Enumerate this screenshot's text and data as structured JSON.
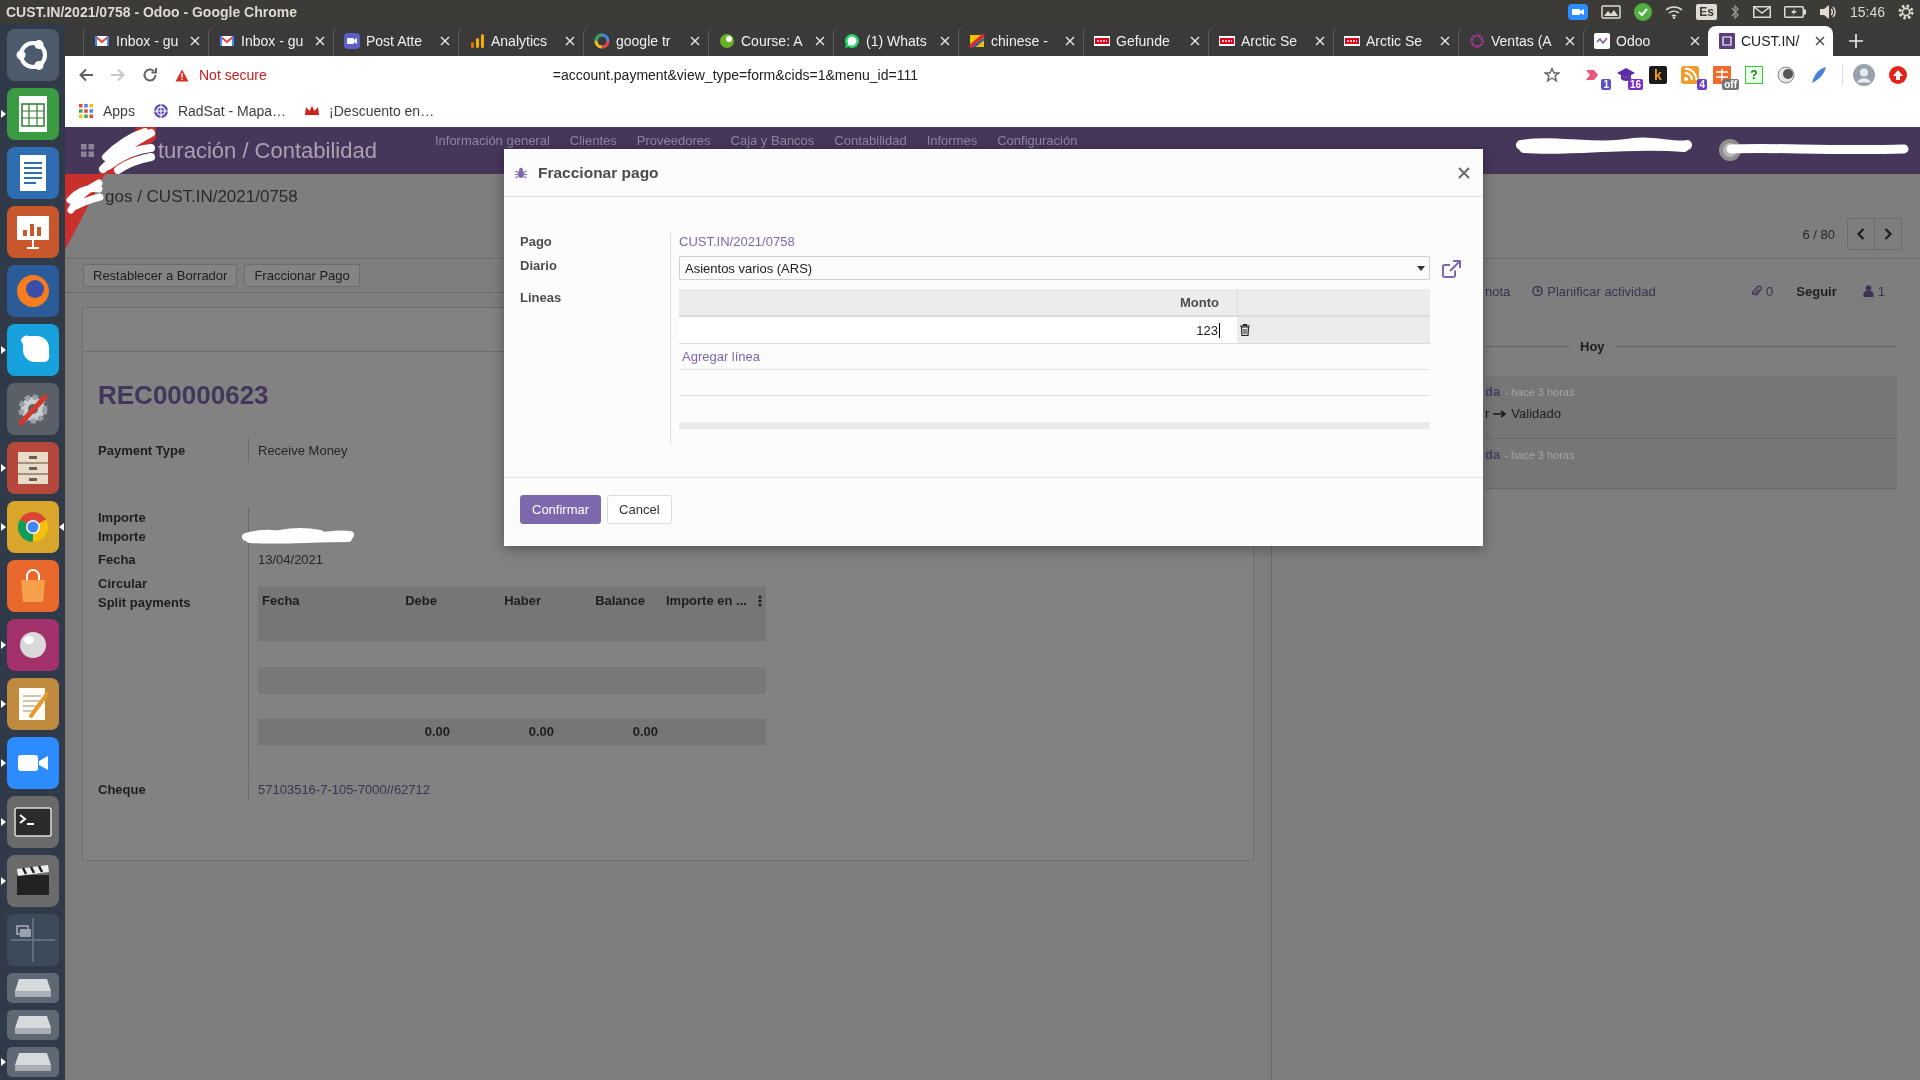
{
  "top_bar": {
    "title": "CUST.IN/2021/0758 - Odoo - Google Chrome",
    "keyboard": "Es",
    "time": "15:46"
  },
  "dock": [
    {
      "kind": "dash",
      "running": false,
      "focused": false
    },
    {
      "kind": "spreadsheet",
      "running": true,
      "focused": false
    },
    {
      "kind": "document",
      "running": false,
      "focused": false
    },
    {
      "kind": "presentation",
      "running": false,
      "focused": false
    },
    {
      "kind": "firefox",
      "running": false,
      "focused": false
    },
    {
      "kind": "skype",
      "running": true,
      "focused": false
    },
    {
      "kind": "settings",
      "running": false,
      "focused": false
    },
    {
      "kind": "files",
      "running": true,
      "focused": false
    },
    {
      "kind": "chrome",
      "running": true,
      "focused": true
    },
    {
      "kind": "store",
      "running": false,
      "focused": false
    },
    {
      "kind": "sphere",
      "running": true,
      "focused": false
    },
    {
      "kind": "notepad",
      "running": true,
      "focused": false
    },
    {
      "kind": "video",
      "running": true,
      "focused": false
    },
    {
      "kind": "terminal",
      "running": true,
      "focused": false
    },
    {
      "kind": "clapperboard",
      "running": true,
      "focused": false
    },
    {
      "kind": "workspaces",
      "running": false,
      "focused": false
    },
    {
      "kind": "drive",
      "running": false,
      "focused": false
    },
    {
      "kind": "drive",
      "running": false,
      "focused": false
    },
    {
      "kind": "drive",
      "running": true,
      "focused": false
    }
  ],
  "tabs": [
    {
      "title": "Inbox - gu",
      "kind": "mail",
      "selected": false
    },
    {
      "title": "Inbox - gu",
      "kind": "mail",
      "selected": false
    },
    {
      "title": "Post Atte",
      "kind": "video",
      "selected": false
    },
    {
      "title": "Analytics",
      "kind": "analytics",
      "selected": false
    },
    {
      "title": "google tr",
      "kind": "google",
      "selected": false
    },
    {
      "title": "Course: A",
      "kind": "course",
      "selected": false
    },
    {
      "title": "(1) Whats",
      "kind": "whatsapp",
      "selected": false
    },
    {
      "title": "chinese -",
      "kind": "flag",
      "selected": false
    },
    {
      "title": "Gefunde",
      "kind": "otto",
      "selected": false
    },
    {
      "title": "Arctic Se",
      "kind": "otto",
      "selected": false
    },
    {
      "title": "Arctic Se",
      "kind": "otto",
      "selected": false
    },
    {
      "title": "Ventas (A",
      "kind": "ring",
      "selected": false
    },
    {
      "title": "Odoo",
      "kind": "odoo",
      "selected": false
    },
    {
      "title": "CUST.IN/",
      "kind": "app",
      "selected": true
    }
  ],
  "nav_buttons": [
    {
      "kind": "back",
      "disabled": false
    },
    {
      "kind": "forward",
      "disabled": true
    },
    {
      "kind": "reload",
      "disabled": false
    }
  ],
  "address_bar": {
    "security": "Not secure",
    "url": "=account.payment&view_type=form&cids=1&menu_id=111"
  },
  "extensions": [
    {
      "kind": "arrows",
      "badge": "1"
    },
    {
      "kind": "cap",
      "badge": "16"
    },
    {
      "kind": "letter",
      "glyph": "k"
    },
    {
      "kind": "feed",
      "badge": "4"
    },
    {
      "kind": "grid",
      "badge": "off"
    },
    {
      "kind": "help",
      "glyph": "?"
    },
    {
      "kind": "moon"
    },
    {
      "kind": "feather"
    }
  ],
  "bookmarks": [
    {
      "kind": "apps",
      "label": "Apps"
    },
    {
      "kind": "globe",
      "label": "RadSat - Mapa…"
    },
    {
      "kind": "crown",
      "label": "¡Descuento en…"
    }
  ],
  "navbar": {
    "app_title": "turación / Contabilidad",
    "menu": [
      "Información general",
      "Clientes",
      "Proveedores",
      "Caja y Bancos",
      "Contabilidad",
      "Informes",
      "Configuración"
    ]
  },
  "control_panel": {
    "breadcrumb": "gos / CUST.IN/2021/0758",
    "pager": "6 / 80"
  },
  "header_buttons": [
    "Restablecer a Borrador",
    "Fraccionar Pago"
  ],
  "form": {
    "title": "REC00000623",
    "payment_type": {
      "label": "Payment Type",
      "value": "Receive Money"
    },
    "fields": [
      {
        "label": "Importe",
        "redacted": false
      },
      {
        "label": "Importe",
        "redacted": true
      },
      {
        "label": "Fecha",
        "value": "13/04/2021",
        "redacted": false
      },
      {
        "label": "Circular",
        "redacted": false
      }
    ],
    "split_payments": {
      "label": "Split payments",
      "columns": [
        {
          "label": "Fecha",
          "kind": "text"
        },
        {
          "label": "Debe",
          "kind": "number",
          "total": "0.00"
        },
        {
          "label": "Haber",
          "kind": "number",
          "total": "0.00"
        },
        {
          "label": "Balance",
          "kind": "number",
          "total": "0.00"
        },
        {
          "label": "Importe en ...",
          "kind": "text"
        }
      ]
    },
    "cheque": {
      "label": "Cheque",
      "value": "57103516-7-105-7000//62712"
    }
  },
  "chatter": {
    "log_note": "nota",
    "schedule": "Planificar actividad",
    "attachments": "0",
    "follow": "Seguir",
    "followers": "1",
    "date": "Hoy",
    "messages": [
      {
        "author": "da",
        "time": "- hace 3 horas",
        "old_value": "r",
        "new_value": "Validado"
      },
      {
        "author": "da",
        "time": "- hace 3 horas"
      }
    ]
  },
  "dialog": {
    "title": "Fraccionar pago",
    "payment": {
      "label": "Pago",
      "value": "CUST.IN/2021/0758"
    },
    "journal": {
      "label": "Diario",
      "value": "Asientos varios (ARS)"
    },
    "lines": {
      "label": "Lineas",
      "column": "Monto",
      "rows": [
        {
          "amount": "123",
          "editing": true
        }
      ],
      "add_line": "Agregar línea"
    },
    "buttons": [
      {
        "label": "Confirmar",
        "kind": "primary"
      },
      {
        "label": "Cancel",
        "kind": "secondary"
      }
    ]
  }
}
